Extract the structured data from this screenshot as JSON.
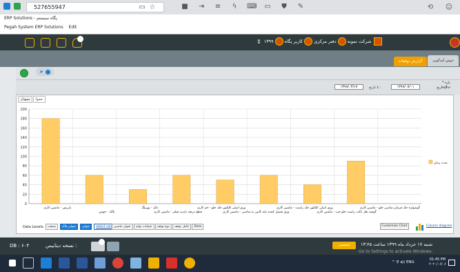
{
  "browser": {
    "url": "527655947",
    "icons": [
      "back-icon",
      "forward-icon",
      "minimize-icon",
      "tab-icon",
      "lightning-icon",
      "screen-icon",
      "dialog-icon",
      "shield-icon",
      "pen-icon",
      "history-icon",
      "person-icon"
    ]
  },
  "app": {
    "title": "ERP Solutions - پگاه سیستم",
    "menu": [
      "Pegah System ERP Solutions",
      "Edit"
    ]
  },
  "toolbar": {
    "company": "شرکت نمونه",
    "office": "دفتر مرکزی",
    "user": "کاربر پگاه",
    "year": "۱۳۹۹",
    "badge": "۰"
  },
  "tabs": {
    "report": "گزارش توقفات",
    "welcome": "خوش آمدگویی"
  },
  "params": {
    "range_label": "* بازه برنامه",
    "from_label": "از تاریخ :",
    "from_value": "۱۳۹۹/۰۷/۰۱",
    "to_label": "تا تاریخ :",
    "to_value": "۱۳۹۹/۰۳/۱۷"
  },
  "view_tabs": [
    "جدول",
    "نمودار"
  ],
  "chart_data": {
    "type": "bar",
    "ylim": [
      0,
      200
    ],
    "yticks": [
      0,
      20,
      40,
      60,
      80,
      100,
      120,
      140,
      160,
      180,
      200
    ],
    "categories": [
      "بازرس - ماشین کاری",
      "بالک - جوش",
      "دکل - بورینگ",
      "قطع دریچه بازدید فیلتر - ماشین کاری",
      "ورق اصلی کلکتور جک جلو - خم کاری",
      "ورق فصیل کننده پایه کابین به شاسی - ماشین کاری",
      "ورق اصلی کلکتور جک راست - ماشین کاری",
      "گوشه بغل باکت راست جلو چپ - ماشین کاری",
      "گوشواره جک فرمان شاسی جلو - ماشین کاری"
    ],
    "series": [
      {
        "name": "مدت زمان",
        "values": [
          180,
          60,
          30,
          60,
          50,
          60,
          40,
          90,
          0
        ],
        "color": "#ffcc66"
      }
    ],
    "legend": "right"
  },
  "bottom": {
    "data_levels_label": "Data Levels:",
    "levels": [
      "شیفت",
      "عنوان پلاک",
      "عنوان",
      "select value",
      "value",
      "عنوان ماشین",
      "عملیات تولید",
      "نوع توقف",
      "عامل توقف"
    ],
    "data_label": "Data",
    "customize": "Customize Chart",
    "column_diagram": "Column diagram"
  },
  "status": {
    "db": "DB : ۶۰۴",
    "version": "نسخه دیتابیس :",
    "shamsi": "شمسی",
    "datetime": "شنبه ۱۷ خرداد ماه ۱۳۹۹ ساعت ۱۳:۴۵",
    "watermark": "Go to Settings to activate Windows."
  },
  "taskbar": {
    "lang": "ENG",
    "time": "01:45 PM",
    "date": "۲۰۲۰/۰۶/۰۶"
  }
}
